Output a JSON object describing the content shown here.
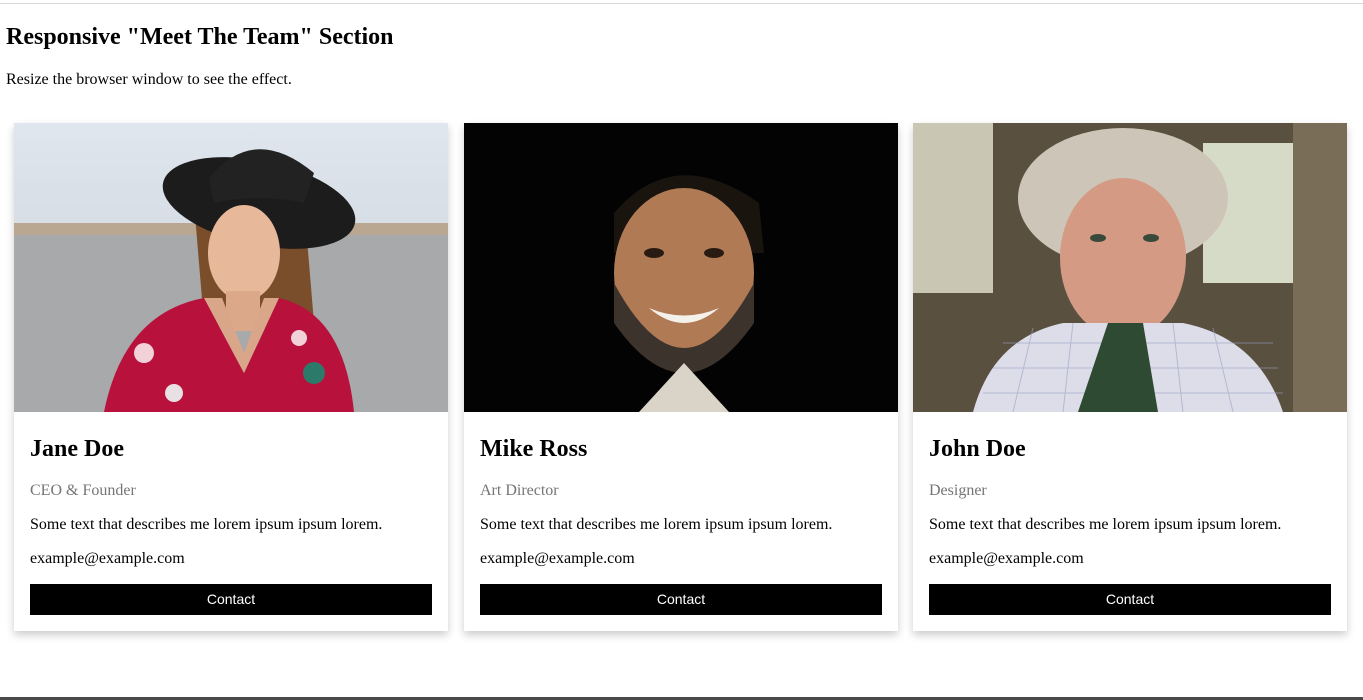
{
  "page": {
    "title": "Responsive \"Meet The Team\" Section",
    "subtitle": "Resize the browser window to see the effect."
  },
  "team": [
    {
      "name": "Jane Doe",
      "title": "CEO & Founder",
      "description": "Some text that describes me lorem ipsum ipsum lorem.",
      "email": "example@example.com",
      "button_label": "Contact"
    },
    {
      "name": "Mike Ross",
      "title": "Art Director",
      "description": "Some text that describes me lorem ipsum ipsum lorem.",
      "email": "example@example.com",
      "button_label": "Contact"
    },
    {
      "name": "John Doe",
      "title": "Designer",
      "description": "Some text that describes me lorem ipsum ipsum lorem.",
      "email": "example@example.com",
      "button_label": "Contact"
    }
  ],
  "colors": {
    "button_bg": "#000000",
    "button_text": "#ffffff",
    "title_gray": "#757575"
  }
}
